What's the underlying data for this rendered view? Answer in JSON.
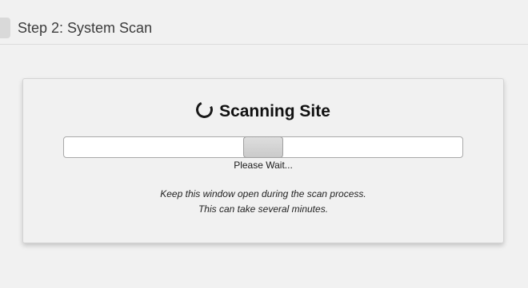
{
  "header": {
    "step_title": "Step 2: System Scan"
  },
  "scan": {
    "title": "Scanning Site",
    "spinner_icon": "spinner-icon",
    "progress_indicator_position": 0.5,
    "wait_label": "Please Wait...",
    "note_line1": "Keep this window open during the scan process.",
    "note_line2": "This can take several minutes."
  }
}
